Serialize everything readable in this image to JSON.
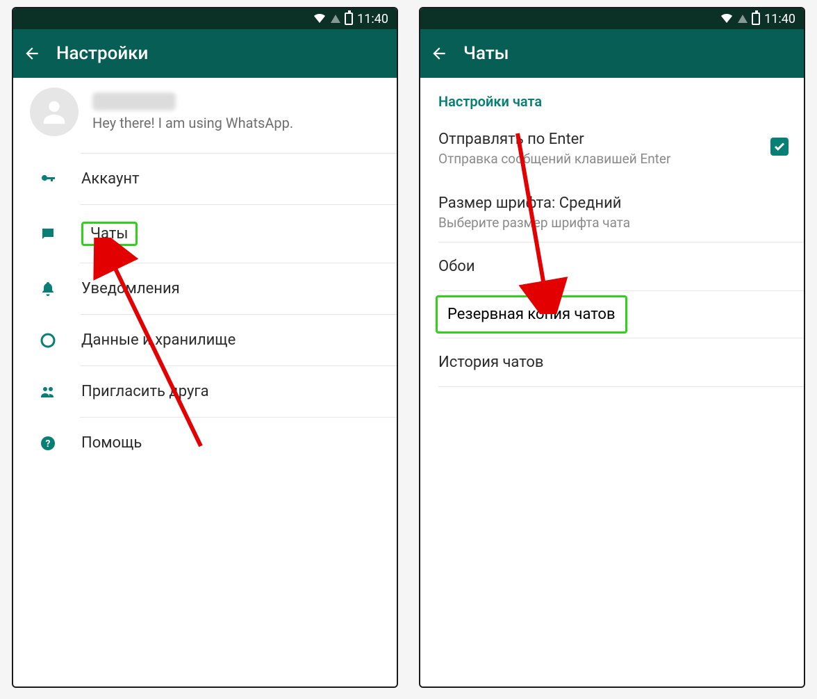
{
  "statusbar": {
    "time": "11:40"
  },
  "left": {
    "title": "Настройки",
    "profile_status": "Hey there! I am using WhatsApp.",
    "menu": {
      "account": "Аккаунт",
      "chats": "Чаты",
      "notifications": "Уведомления",
      "data": "Данные и хранилище",
      "invite": "Пригласить друга",
      "help": "Помощь"
    }
  },
  "right": {
    "title": "Чаты",
    "section_header": "Настройки чата",
    "enter": {
      "title": "Отправлять по Enter",
      "sub": "Отправка сообщений клавишей Enter",
      "checked": true
    },
    "fontsize": {
      "title": "Размер шрифта: Средний",
      "sub": "Выберите размер шрифта чата"
    },
    "wallpaper": "Обои",
    "backup": "Резервная копия чатов",
    "history": "История чатов"
  }
}
